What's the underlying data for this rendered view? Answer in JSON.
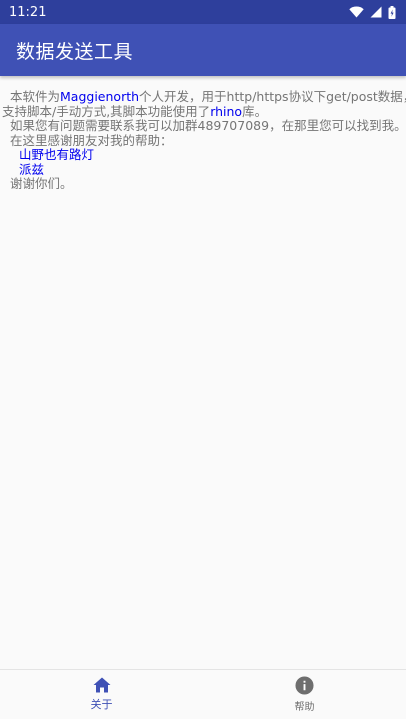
{
  "status_bar": {
    "time": "11:21",
    "icons": [
      "wifi-icon",
      "signal-icon",
      "battery-icon"
    ]
  },
  "app_bar": {
    "title": "数据发送工具"
  },
  "about": {
    "intro_prefix": "本软件为",
    "author": "Maggienorth",
    "intro_suffix": "个人开发，用于http/https协议下get/post数据，",
    "line2_prefix": "支持脚本/手动方式,其脚本功能使用了",
    "library": "rhino",
    "line2_suffix": "库。",
    "contact": "如果您有问题需要联系我可以加群489707089，在那里您可以找到我。",
    "thanks_intro": "在这里感谢朋友对我的帮助：",
    "friends": [
      "山野也有路灯",
      "派兹"
    ],
    "closing": "谢谢你们。"
  },
  "bottom_nav": {
    "items": [
      {
        "label": "关于",
        "icon": "home-icon",
        "active": true
      },
      {
        "label": "帮助",
        "icon": "info-icon",
        "active": false
      }
    ]
  },
  "colors": {
    "status_bar": "#2e3f9c",
    "app_bar": "#3f51b5",
    "link": "#0000ee",
    "body_text": "#757575",
    "active_nav": "#3f51b5",
    "inactive_nav": "#6e6e6e"
  }
}
